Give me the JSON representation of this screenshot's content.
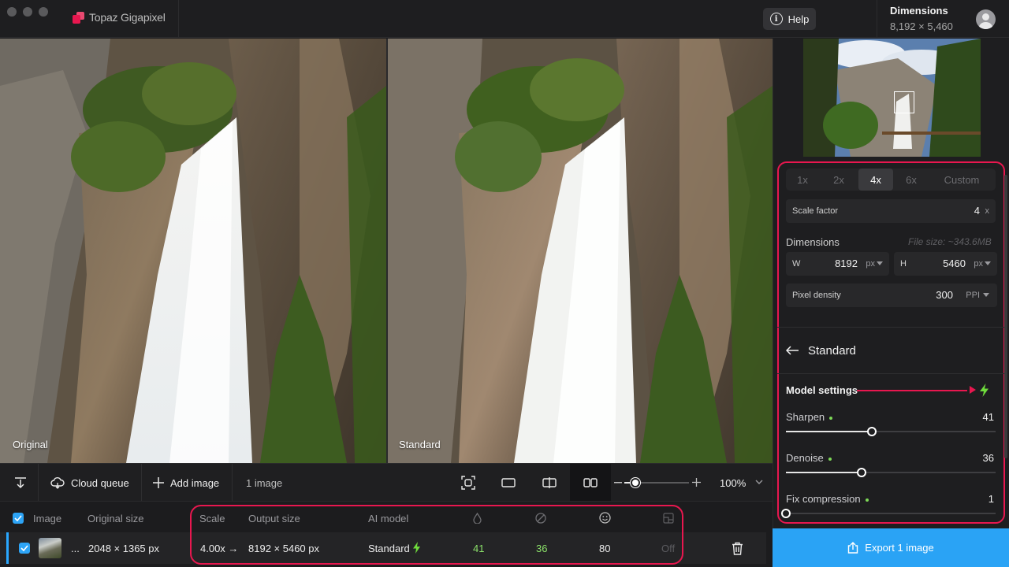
{
  "app": {
    "name": "Topaz Gigapixel",
    "help_label": "Help",
    "dimensions_label": "Dimensions",
    "dimensions_value": "8,192 × 5,460"
  },
  "viewer": {
    "left_label": "Original",
    "right_label": "Standard"
  },
  "toolbar": {
    "cloud_queue_label": "Cloud queue",
    "add_image_label": "Add image",
    "image_count": "1 image",
    "zoom_value": "100%",
    "zoom_level": 0.17
  },
  "list": {
    "headers": {
      "image": "Image",
      "original_size": "Original size",
      "scale": "Scale",
      "output_size": "Output size",
      "ai_model": "AI model"
    },
    "row": {
      "ellipsis": "...",
      "original_size": "2048 × 1365 px",
      "scale": "4.00x →",
      "output_size": "8192 × 5460 px",
      "ai_model": "Standard",
      "sharpen": "41",
      "denoise": "36",
      "face": "80",
      "compression": "Off"
    }
  },
  "panel": {
    "scale_options": [
      "1x",
      "2x",
      "4x",
      "6x",
      "Custom"
    ],
    "selected_scale": "4x",
    "scale_factor_label": "Scale factor",
    "scale_factor_value": "4",
    "scale_factor_unit": "x",
    "dimensions_label": "Dimensions",
    "file_size_hint": "File size: ~343.6MB",
    "width_label": "W",
    "width_value": "8192",
    "width_unit": "px",
    "height_label": "H",
    "height_value": "5460",
    "height_unit": "px",
    "pixel_density_label": "Pixel density",
    "pixel_density_value": "300",
    "pixel_density_unit": "PPI",
    "model_name": "Standard",
    "model_settings_label": "Model settings",
    "sliders": [
      {
        "label": "Sharpen",
        "value": "41",
        "fraction": 0.41
      },
      {
        "label": "Denoise",
        "value": "36",
        "fraction": 0.36
      },
      {
        "label": "Fix compression",
        "value": "1",
        "fraction": 0.0
      }
    ]
  },
  "export_label": "Export 1 image",
  "colors": {
    "accent": "#2aa3f5",
    "highlight": "#e8174f",
    "green": "#8ce26a"
  }
}
